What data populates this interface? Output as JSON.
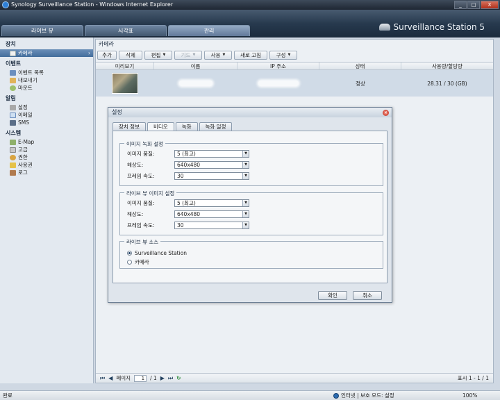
{
  "window": {
    "title": "Synology Surveillance Station - Windows Internet Explorer",
    "buttons": {
      "minimize": "_",
      "maximize": "□",
      "close": "X"
    }
  },
  "header": {
    "tabs": [
      "라이브 뷰",
      "시각표",
      "관리"
    ],
    "active_tab": "관리",
    "brand": "Surveillance Station 5"
  },
  "sidebar": {
    "sections": [
      {
        "title": "장치",
        "items": [
          {
            "label": "카메라",
            "icon": "camera-icon",
            "active": true
          }
        ]
      },
      {
        "title": "이벤트",
        "items": [
          {
            "label": "이벤트 목록",
            "icon": "list-icon"
          },
          {
            "label": "내보내기",
            "icon": "export-icon"
          },
          {
            "label": "마운트",
            "icon": "mount-icon"
          }
        ]
      },
      {
        "title": "알림",
        "items": [
          {
            "label": "설정",
            "icon": "wrench-icon"
          },
          {
            "label": "이메일",
            "icon": "email-icon"
          },
          {
            "label": "SMS",
            "icon": "sms-icon"
          }
        ]
      },
      {
        "title": "시스템",
        "items": [
          {
            "label": "E-Map",
            "icon": "map-icon"
          },
          {
            "label": "고급",
            "icon": "advanced-icon"
          },
          {
            "label": "권한",
            "icon": "permission-icon"
          },
          {
            "label": "사용권",
            "icon": "key-icon"
          },
          {
            "label": "로그",
            "icon": "log-icon"
          }
        ]
      }
    ]
  },
  "panel": {
    "title": "카메라",
    "toolbar": [
      {
        "label": "추가",
        "disabled": false,
        "dropdown": false
      },
      {
        "label": "삭제",
        "disabled": false,
        "dropdown": false
      },
      {
        "label": "편집",
        "disabled": false,
        "dropdown": true
      },
      {
        "label": "기드",
        "disabled": true,
        "dropdown": true
      },
      {
        "label": "사용",
        "disabled": false,
        "dropdown": true
      },
      {
        "label": "새로 고침",
        "disabled": false,
        "dropdown": false
      },
      {
        "label": "구성",
        "disabled": false,
        "dropdown": true
      }
    ],
    "columns": [
      "미리보기",
      "이름",
      "IP 주소",
      "상태",
      "사용량/할당량"
    ],
    "rows": [
      {
        "status": "정상",
        "usage": "28.31 / 30 (GB)"
      }
    ]
  },
  "pager": {
    "page_label": "페이지",
    "page": "1",
    "of": "/ 1",
    "display": "표시 1 - 1 / 1"
  },
  "dialog": {
    "title": "설정",
    "tabs": [
      "장치 정보",
      "비디오",
      "녹화",
      "녹화 일정"
    ],
    "active_tab": "비디오",
    "record_group": {
      "legend": "이미지 녹화 설정",
      "fields": [
        {
          "label": "이미지 품질:",
          "value": "5 (최고)"
        },
        {
          "label": "해상도:",
          "value": "640x480"
        },
        {
          "label": "프레임 속도:",
          "value": "30"
        }
      ]
    },
    "live_group": {
      "legend": "라이브 뷰 이미지 설정",
      "fields": [
        {
          "label": "이미지 품질:",
          "value": "5 (최고)"
        },
        {
          "label": "해상도:",
          "value": "640x480"
        },
        {
          "label": "프레임 속도:",
          "value": "30"
        }
      ]
    },
    "source_group": {
      "legend": "라이브 뷰 소스",
      "options": [
        {
          "label": "Surveillance Station",
          "checked": true
        },
        {
          "label": "카메라",
          "checked": false
        }
      ]
    },
    "ok": "확인",
    "cancel": "취소"
  },
  "statusbar": {
    "left": "완료",
    "zone": "인터넷 | 보호 모드: 설정",
    "zoom": "100%"
  }
}
